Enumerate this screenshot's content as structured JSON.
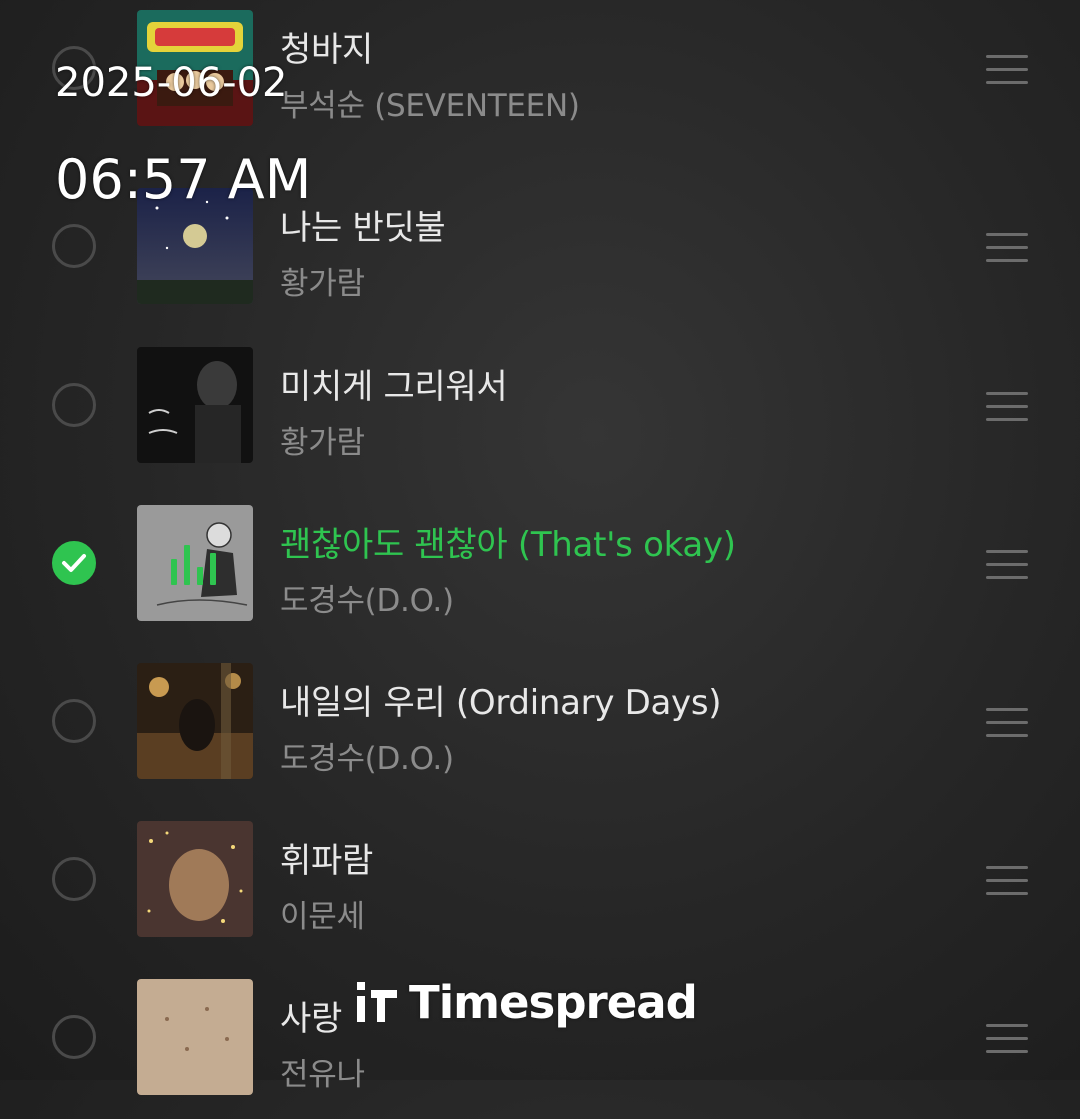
{
  "overlay": {
    "date": "2025-06-02",
    "time": "06:57 AM"
  },
  "playlist": {
    "tracks": [
      {
        "title": "청바지",
        "artist": "부석순 (SEVENTEEN)",
        "selected": false,
        "playing": false,
        "cover_colors": [
          "#1b6b5d",
          "#7a1e1e"
        ]
      },
      {
        "title": "나는 반딧불",
        "artist": "황가람",
        "selected": false,
        "playing": false,
        "cover_colors": [
          "#1a2040",
          "#3b3f55"
        ]
      },
      {
        "title": "미치게 그리워서",
        "artist": "황가람",
        "selected": false,
        "playing": false,
        "cover_colors": [
          "#0e0e0e",
          "#2a2a2a"
        ]
      },
      {
        "title": "괜찮아도 괜찮아 (That's okay)",
        "artist": "도경수(D.O.)",
        "selected": true,
        "playing": true,
        "cover_colors": [
          "#8a8a8a",
          "#a3a3a3"
        ]
      },
      {
        "title": "내일의 우리 (Ordinary Days)",
        "artist": "도경수(D.O.)",
        "selected": false,
        "playing": false,
        "cover_colors": [
          "#2b1f14",
          "#6e4f2c"
        ]
      },
      {
        "title": "휘파람",
        "artist": "이문세",
        "selected": false,
        "playing": false,
        "cover_colors": [
          "#3d2d2a",
          "#7a5a40"
        ]
      },
      {
        "title": "사랑",
        "artist": "전유나",
        "selected": false,
        "playing": false,
        "cover_colors": [
          "#b59a80",
          "#d2bca4"
        ]
      }
    ]
  },
  "watermark": {
    "text": "Timespread",
    "icon": "timespread-logo-icon"
  },
  "colors": {
    "accent": "#2fc450",
    "text_primary": "#e8e8e8",
    "text_secondary": "#8b8b8b",
    "background": "#262626"
  }
}
